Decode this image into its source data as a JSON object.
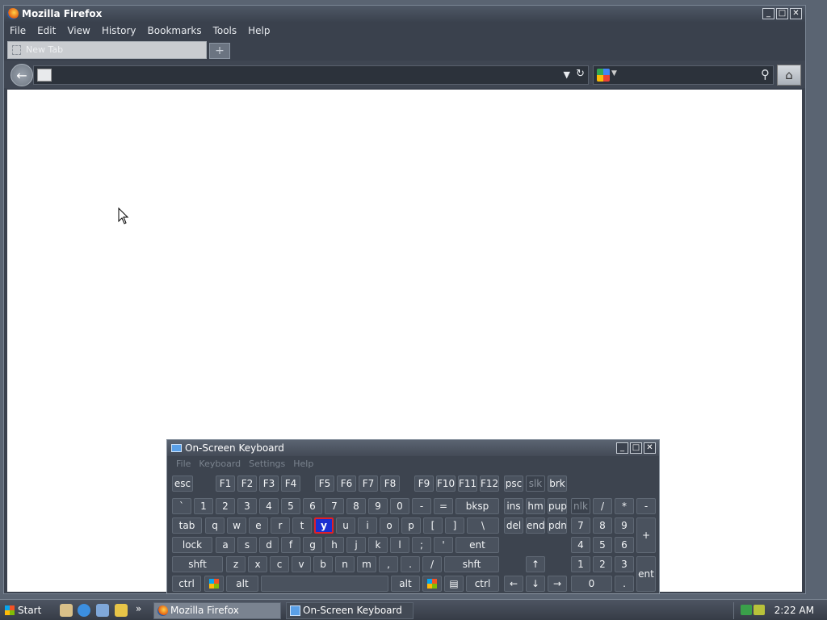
{
  "firefox": {
    "title": "Mozilla Firefox",
    "menu": [
      "File",
      "Edit",
      "View",
      "History",
      "Bookmarks",
      "Tools",
      "Help"
    ],
    "tab_label": "New Tab",
    "new_tab_symbol": "+",
    "url_value": "",
    "search_placeholder": "",
    "search_engine_icon": "google-icon"
  },
  "window_buttons": {
    "minimize": "_",
    "maximize": "□",
    "close": "✕"
  },
  "osk": {
    "title": "On-Screen Keyboard",
    "menu": [
      "File",
      "Keyboard",
      "Settings",
      "Help"
    ],
    "selected_key": "y"
  },
  "taskbar": {
    "start_label": "Start",
    "quicklaunch_icons": [
      "desktop-icon",
      "ie-icon",
      "outlook-icon",
      "media-icon"
    ],
    "items": [
      "Mozilla Firefox",
      "On-Screen Keyboard"
    ],
    "clock": "2:22 AM"
  },
  "accent_colors": {
    "selected_key_fill": "#1a2fd0",
    "selected_key_border": "#e0202a"
  }
}
